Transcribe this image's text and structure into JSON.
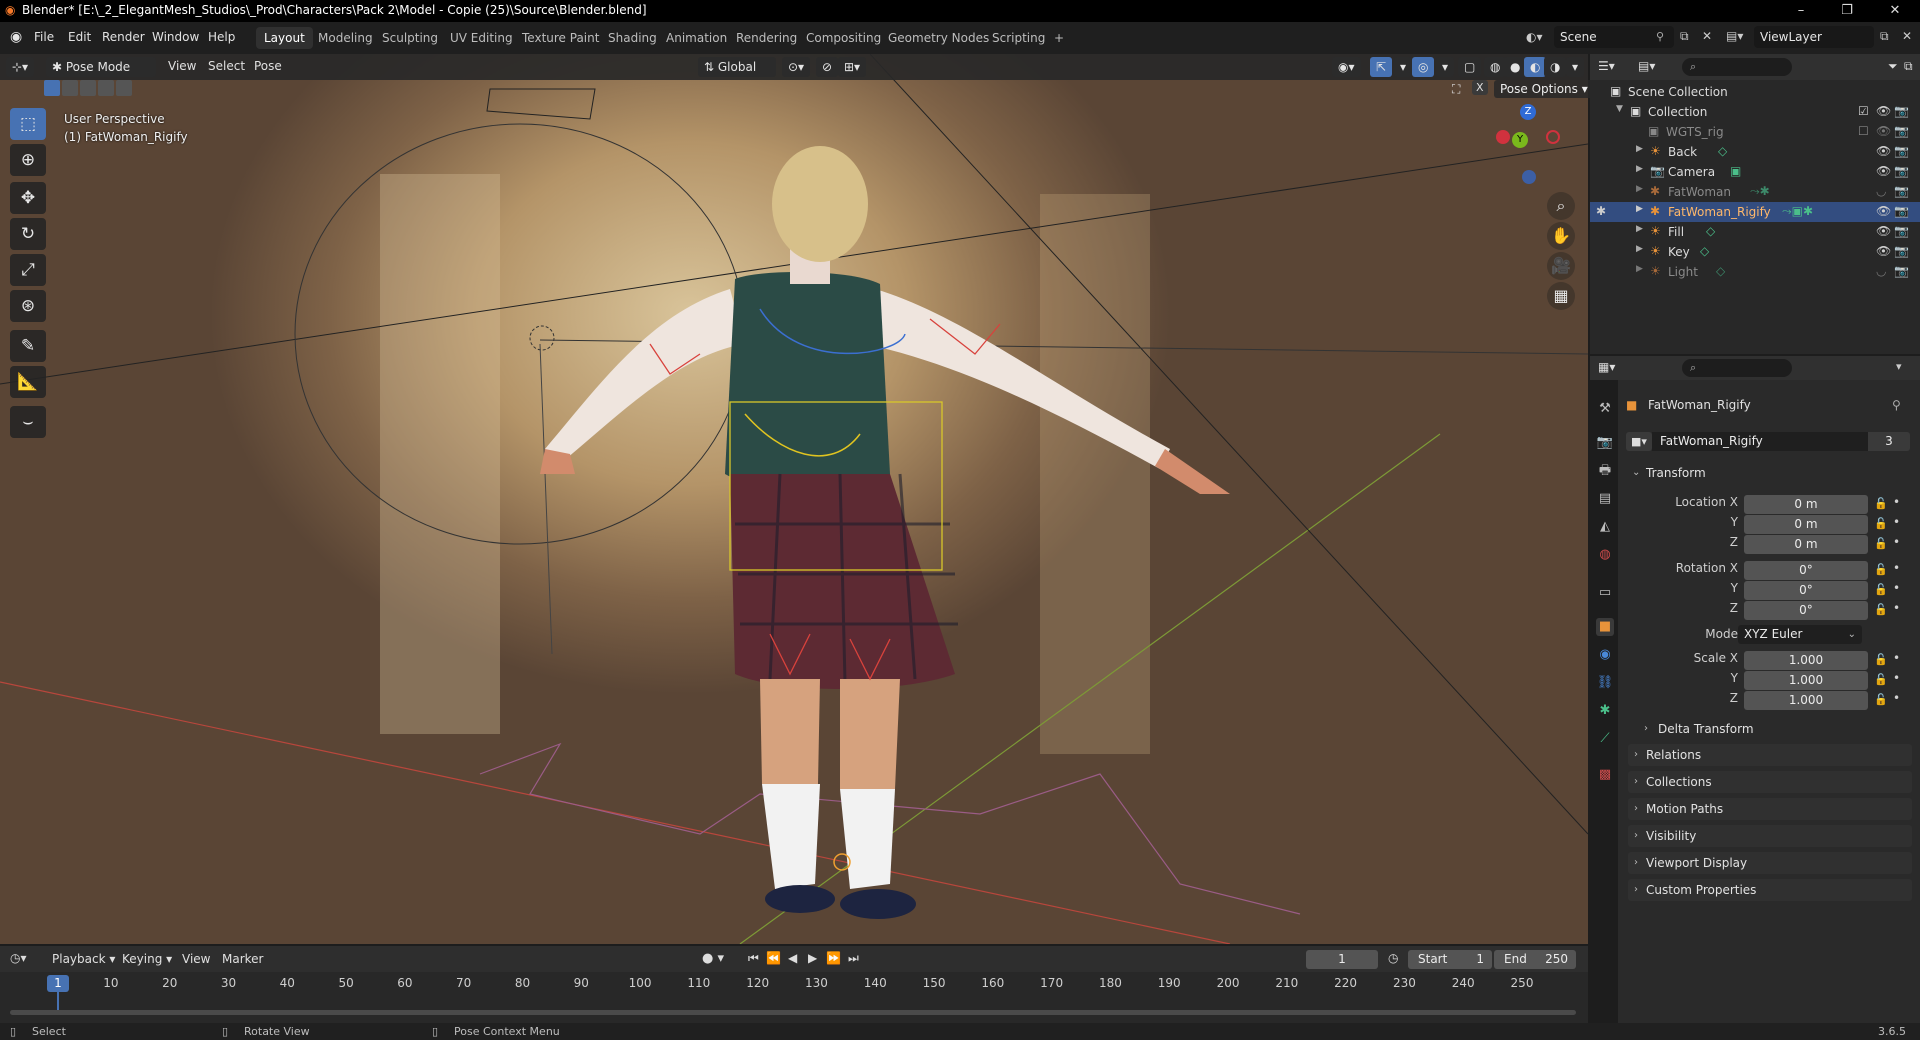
{
  "title_bar": {
    "title": "Blender* [E:\\_2_ElegantMesh_Studios\\_Prod\\Characters\\Pack 2\\Model - Copie (25)\\Source\\Blender.blend]",
    "controls": [
      "–",
      "❐",
      "✕"
    ]
  },
  "menu": {
    "items": [
      "File",
      "Edit",
      "Render",
      "Window",
      "Help"
    ]
  },
  "workspaces": {
    "tabs": [
      "Layout",
      "Modeling",
      "Sculpting",
      "UV Editing",
      "Texture Paint",
      "Shading",
      "Animation",
      "Rendering",
      "Compositing",
      "Geometry Nodes",
      "Scripting"
    ],
    "active": "Layout",
    "add": "+"
  },
  "scene": {
    "scene_name": "Scene",
    "view_layer": "ViewLayer"
  },
  "viewport_header": {
    "mode": "Pose Mode",
    "menus": [
      "View",
      "Select",
      "Pose"
    ],
    "orientation": "Global",
    "pose_options": "Pose Options"
  },
  "viewport": {
    "perspective": "User Perspective",
    "active_object": "(1) FatWoman_Rigify",
    "gizmo": {
      "x": "X",
      "y": "Y",
      "z": "Z"
    }
  },
  "tools": [
    "select-box",
    "cursor",
    "move",
    "rotate",
    "scale",
    "transform",
    "annotate",
    "measure",
    "relax"
  ],
  "outliner": {
    "root": "Scene Collection",
    "collection": "Collection",
    "items": [
      {
        "name": "WGTS_rig",
        "dim": true
      },
      {
        "name": "Back",
        "dim": false
      },
      {
        "name": "Camera",
        "dim": false
      },
      {
        "name": "FatWoman",
        "dim": true
      },
      {
        "name": "FatWoman_Rigify",
        "dim": false,
        "selected": true
      },
      {
        "name": "Fill",
        "dim": false
      },
      {
        "name": "Key",
        "dim": false
      },
      {
        "name": "Light",
        "dim": true
      }
    ]
  },
  "properties": {
    "object_name": "FatWoman_Rigify",
    "datablock": "FatWoman_Rigify",
    "users": "3",
    "transform": {
      "title": "Transform",
      "location_label": "Location X",
      "location": [
        "0 m",
        "0 m",
        "0 m"
      ],
      "rotation_label": "Rotation X",
      "rotation": [
        "0°",
        "0°",
        "0°"
      ],
      "mode_label": "Mode",
      "mode": "XYZ Euler",
      "scale_label": "Scale X",
      "scale": [
        "1.000",
        "1.000",
        "1.000"
      ],
      "y": "Y",
      "z": "Z"
    },
    "panels": [
      "Delta Transform",
      "Relations",
      "Collections",
      "Motion Paths",
      "Visibility",
      "Viewport Display",
      "Custom Properties"
    ]
  },
  "timeline": {
    "menus": [
      "Playback",
      "Keying",
      "View",
      "Marker"
    ],
    "current_frame": "1",
    "start_label": "Start",
    "start": "1",
    "end_label": "End",
    "end": "250",
    "ticks": [
      "10",
      "20",
      "30",
      "40",
      "50",
      "60",
      "70",
      "80",
      "90",
      "100",
      "110",
      "120",
      "130",
      "140",
      "150",
      "160",
      "170",
      "180",
      "190",
      "200",
      "210",
      "220",
      "230",
      "240",
      "250"
    ],
    "playhead": "1"
  },
  "status_bar": {
    "left": "Select",
    "middle": "Rotate View",
    "right": "Pose Context Menu",
    "version": "3.6.5"
  }
}
